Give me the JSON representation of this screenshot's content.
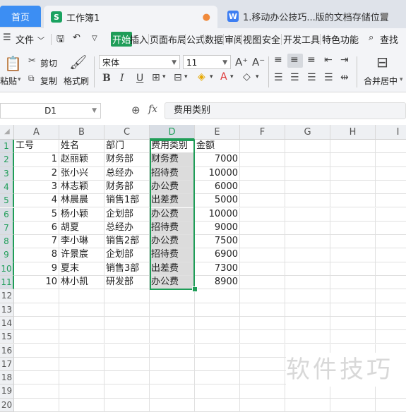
{
  "tabs": {
    "home": "首页",
    "workbook": "工作簿1",
    "workbook_icon": "S",
    "document": "1.移动办公技巧...版的文档存储位置",
    "document_icon": "W"
  },
  "menu": {
    "file": "文件",
    "items": [
      "开始",
      "插入",
      "页面布局",
      "公式",
      "数据",
      "审阅",
      "视图",
      "安全",
      "开发工具",
      "特色功能"
    ],
    "search": "查找"
  },
  "ribbon": {
    "paste": "粘贴",
    "cut": "剪切",
    "copy": "复制",
    "format_painter": "格式刷",
    "font_name": "宋体",
    "font_size": "11",
    "merge_center": "合并居中"
  },
  "formula_bar": {
    "name_box": "D1",
    "fx": "fx",
    "content": "费用类别"
  },
  "columns": [
    "A",
    "B",
    "C",
    "D",
    "E",
    "F",
    "G",
    "H",
    "I"
  ],
  "rows": [
    "1",
    "2",
    "3",
    "4",
    "5",
    "6",
    "7",
    "8",
    "9",
    "10",
    "11",
    "12",
    "13",
    "14",
    "15",
    "16",
    "17",
    "18",
    "19",
    "20"
  ],
  "table": {
    "header": [
      "工号",
      "姓名",
      "部门",
      "费用类别",
      "金额"
    ],
    "data": [
      [
        "1",
        "赵丽颖",
        "财务部",
        "财务费",
        "7000"
      ],
      [
        "2",
        "张小兴",
        "总经办",
        "招待费",
        "10000"
      ],
      [
        "3",
        "林志颖",
        "财务部",
        "办公费",
        "6000"
      ],
      [
        "4",
        "林晨晨",
        "销售1部",
        "出差费",
        "5000"
      ],
      [
        "5",
        "杨小颖",
        "企划部",
        "办公费",
        "10000"
      ],
      [
        "6",
        "胡夏",
        "总经办",
        "招待费",
        "9000"
      ],
      [
        "7",
        "李小琳",
        "销售2部",
        "办公费",
        "7500"
      ],
      [
        "8",
        "许景宸",
        "企划部",
        "招待费",
        "6900"
      ],
      [
        "9",
        "夏末",
        "销售3部",
        "出差费",
        "7300"
      ],
      [
        "10",
        "林小凯",
        "研发部",
        "办公费",
        "8900"
      ]
    ]
  },
  "watermark": "软件技巧",
  "colors": {
    "accent": "#1f9d58",
    "home_tab": "#3c8ef3"
  }
}
